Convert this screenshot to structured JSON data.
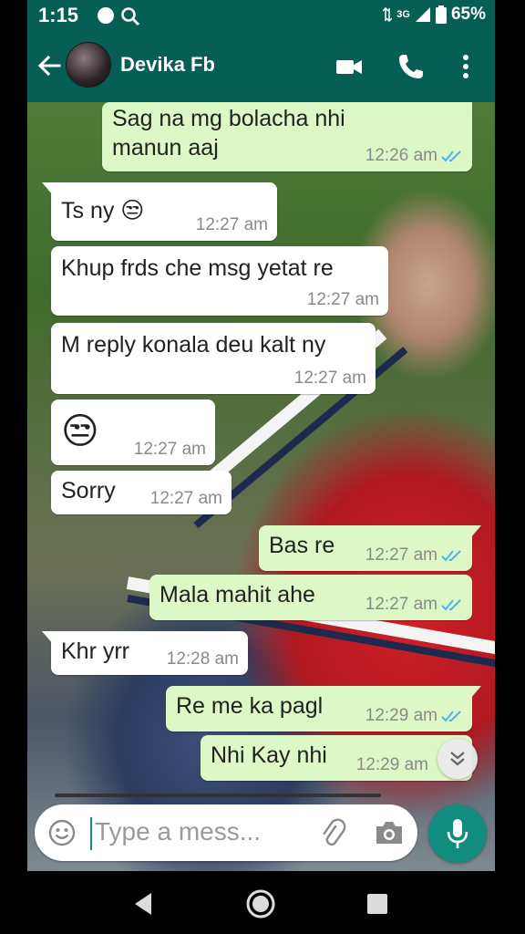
{
  "status_bar": {
    "time": "1:15",
    "network": "3G",
    "battery": "65%"
  },
  "header": {
    "contact_name": "Devika Fb"
  },
  "messages": [
    {
      "dir": "out",
      "line1": "Sag na mg bolacha nhi",
      "line2": "manun aaj",
      "time": "12:26 am"
    },
    {
      "dir": "in",
      "text": "Ts ny 😒",
      "time": "12:27 am"
    },
    {
      "dir": "in",
      "text": "Khup frds che msg yetat re",
      "time": "12:27 am"
    },
    {
      "dir": "in",
      "text": "M reply konala deu kalt ny",
      "time": "12:27 am"
    },
    {
      "dir": "in",
      "text": "😒",
      "time": "12:27 am"
    },
    {
      "dir": "in",
      "text": "Sorry",
      "time": "12:27 am"
    },
    {
      "dir": "out",
      "text": "Bas re",
      "time": "12:27 am"
    },
    {
      "dir": "out",
      "text": "Mala mahit ahe",
      "time": "12:27 am"
    },
    {
      "dir": "in",
      "text": "Khr yrr",
      "time": "12:28 am"
    },
    {
      "dir": "out",
      "text": "Re me ka pagl",
      "time": "12:29 am"
    },
    {
      "dir": "out",
      "text": "Nhi Kay nhi",
      "time": "12:29 am"
    }
  ],
  "composer": {
    "placeholder": "Type a mess..."
  },
  "colors": {
    "header": "#075e54",
    "outgoing_bubble": "#dcf8c6",
    "incoming_bubble": "#ffffff",
    "accent": "#128c7e",
    "read_ticks": "#4fb3e6"
  },
  "icons": [
    "back-arrow-icon",
    "video-call-icon",
    "phone-call-icon",
    "more-options-icon",
    "read-ticks-icon",
    "scroll-down-icon",
    "emoji-icon",
    "attach-icon",
    "camera-icon",
    "mic-icon",
    "nav-back-icon",
    "nav-home-icon",
    "nav-recents-icon"
  ]
}
